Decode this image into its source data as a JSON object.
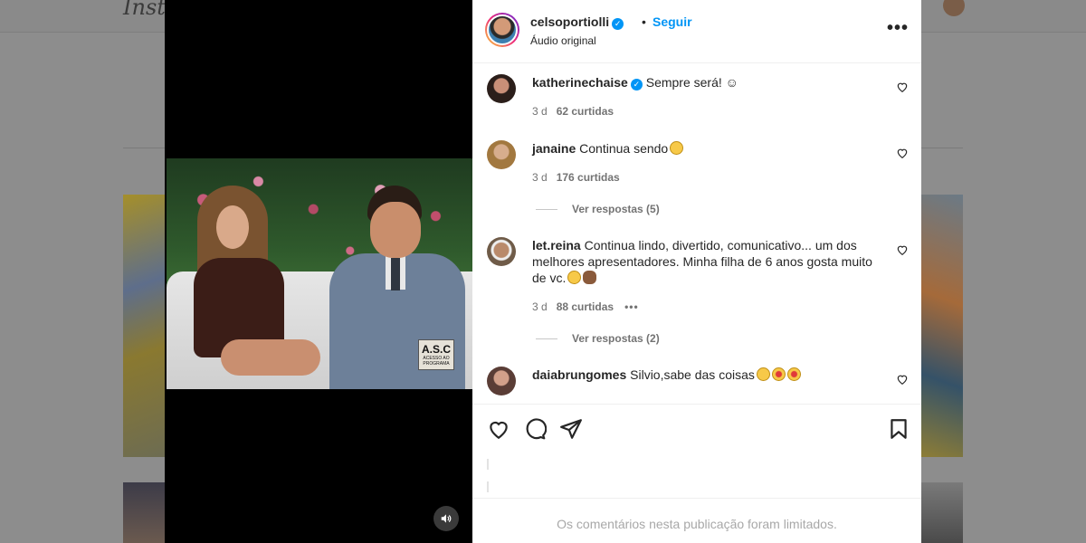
{
  "header": {
    "username": "celsoportiolli",
    "separator": "•",
    "follow_label": "Seguir",
    "audio_label": "Áudio original",
    "more_icon": "more-horizontal-icon"
  },
  "video": {
    "badge_title": "A.S.C",
    "badge_sub": "ACESSO AO PROGRAMA",
    "volume_icon": "speaker-icon"
  },
  "comments": [
    {
      "username": "katherinechaise",
      "verified": true,
      "text": "Sempre será! ☺",
      "age": "3 d",
      "likes": "62 curtidas"
    },
    {
      "username": "janaine",
      "verified": false,
      "text": "Continua sendo",
      "age": "3 d",
      "likes": "176 curtidas",
      "replies": "Ver respostas (5)"
    },
    {
      "username": "let.reina",
      "verified": false,
      "text": "Continua lindo, divertido, comunicativo... um dos melhores apresentadores. Minha filha de 6 anos gosta muito de vc.",
      "age": "3 d",
      "likes": "88 curtidas",
      "more": "•••",
      "replies": "Ver respostas (2)"
    },
    {
      "username": "daiabrungomes",
      "verified": false,
      "text": "Silvio,sabe das coisas"
    }
  ],
  "footer": {
    "limited_text": "Os comentários nesta publicação foram limitados."
  },
  "colors": {
    "accent": "#0095f6",
    "text": "#262626",
    "muted": "#737373"
  }
}
